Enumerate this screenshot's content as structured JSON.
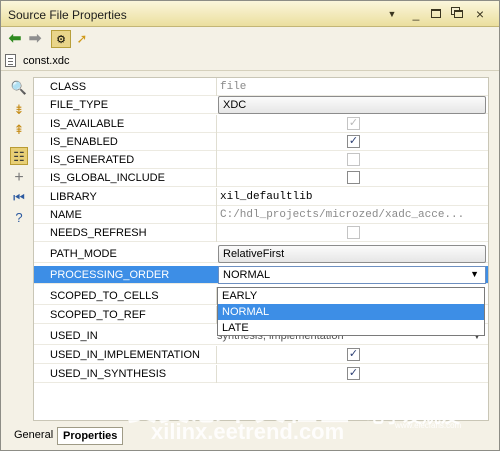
{
  "window": {
    "title": "Source File Properties"
  },
  "file": {
    "name": "const.xdc"
  },
  "properties": [
    {
      "name": "CLASS",
      "value": "file",
      "kind": "text"
    },
    {
      "name": "FILE_TYPE",
      "value": "XDC",
      "kind": "combo"
    },
    {
      "name": "IS_AVAILABLE",
      "value": "checked-disabled",
      "kind": "check"
    },
    {
      "name": "IS_ENABLED",
      "value": "checked",
      "kind": "check"
    },
    {
      "name": "IS_GENERATED",
      "value": "unchecked-disabled",
      "kind": "check"
    },
    {
      "name": "IS_GLOBAL_INCLUDE",
      "value": "unchecked",
      "kind": "check"
    },
    {
      "name": "LIBRARY",
      "value": "xil_defaultlib",
      "kind": "text"
    },
    {
      "name": "NAME",
      "value": "C:/hdl_projects/microzed/xadc_acce...",
      "kind": "text"
    },
    {
      "name": "NEEDS_REFRESH",
      "value": "unchecked-disabled",
      "kind": "check"
    },
    {
      "name": "PATH_MODE",
      "value": "RelativeFirst",
      "kind": "combo"
    },
    {
      "name": "PROCESSING_ORDER",
      "value": "NORMAL",
      "kind": "combo-open"
    },
    {
      "name": "SCOPED_TO_CELLS",
      "value": "",
      "kind": "text"
    },
    {
      "name": "SCOPED_TO_REF",
      "value": "",
      "kind": "text"
    },
    {
      "name": "USED_IN",
      "value": "synthesis, implementation",
      "kind": "text"
    },
    {
      "name": "USED_IN_IMPLEMENTATION",
      "value": "checked",
      "kind": "check"
    },
    {
      "name": "USED_IN_SYNTHESIS",
      "value": "checked",
      "kind": "check"
    }
  ],
  "dropdown": {
    "options": [
      "EARLY",
      "NORMAL",
      "LATE"
    ],
    "selected": "NORMAL"
  },
  "tabs": {
    "general": "General",
    "properties": "Properties"
  },
  "watermark": {
    "line1": "赛灵思中文社区",
    "line2": "xilinx.eetrend.com",
    "logo": "电子发烧友",
    "logo_url": "www.elecfans.com"
  },
  "icons": {
    "back": "arrow-left-icon",
    "forward": "arrow-right-icon",
    "select": "select-objects-icon",
    "cursor": "pointer-icon",
    "sidebar": [
      "search-icon",
      "collapse-all-icon",
      "expand-all-icon",
      "group-icon",
      "add-icon",
      "first-icon",
      "help-icon"
    ]
  }
}
